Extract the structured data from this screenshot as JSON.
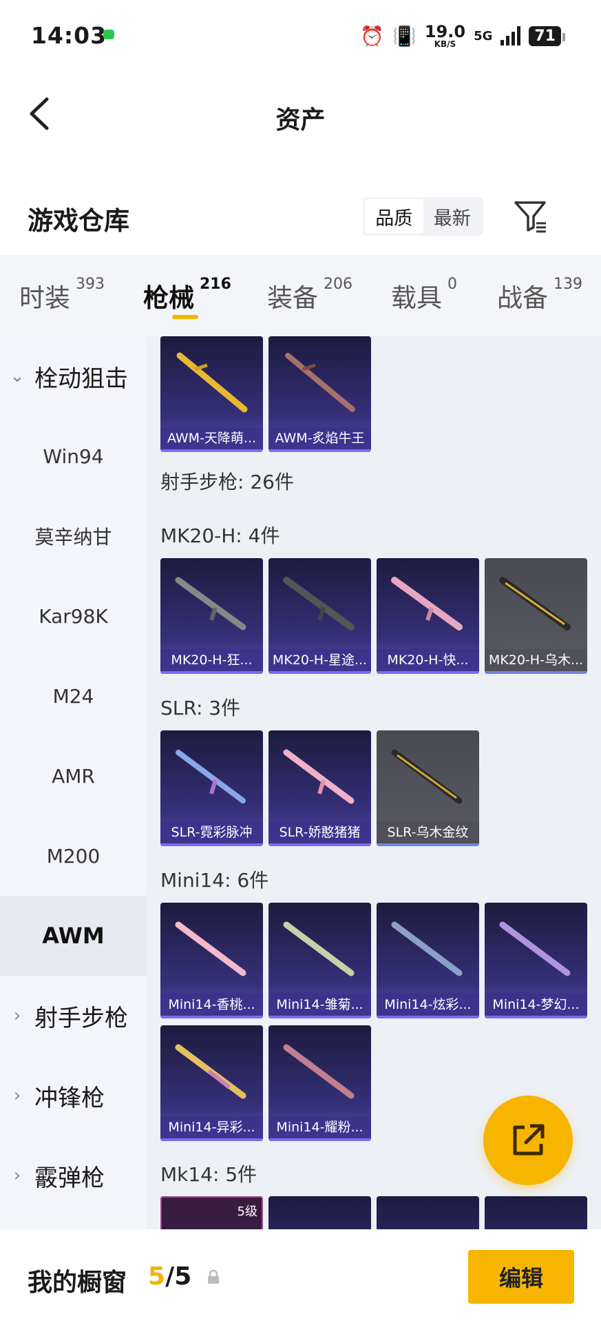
{
  "status": {
    "time": "14:03",
    "speed_value": "19.0",
    "speed_unit": "KB/S",
    "network": "5G",
    "battery": "71"
  },
  "header": {
    "title": "资产"
  },
  "warehouse": {
    "title": "游戏仓库",
    "sort_options": [
      "品质",
      "最新"
    ],
    "selected_sort": "品质"
  },
  "tabs": [
    {
      "label": "时装",
      "count": "393"
    },
    {
      "label": "枪械",
      "count": "216"
    },
    {
      "label": "装备",
      "count": "206"
    },
    {
      "label": "载具",
      "count": "0"
    },
    {
      "label": "战备",
      "count": "139"
    }
  ],
  "active_tab": "枪械",
  "sidebar": {
    "category_open": "栓动狙击",
    "items": [
      "Win94",
      "莫辛纳甘",
      "Kar98K",
      "M24",
      "AMR",
      "M200",
      "AWM"
    ],
    "active_item": "AWM",
    "collapsed_categories": [
      "射手步枪",
      "冲锋枪",
      "霰弹枪"
    ]
  },
  "content": {
    "awm_items": [
      "AWM-天降萌...",
      "AWM-炙焰牛王"
    ],
    "marksman_header": "射手步枪: 26件",
    "mk20_header": "MK20-H: 4件",
    "mk20_items": [
      "MK20-H-狂...",
      "MK20-H-星途...",
      "MK20-H-快...",
      "MK20-H-乌木..."
    ],
    "slr_header": "SLR: 3件",
    "slr_items": [
      "SLR-霓彩脉冲",
      "SLR-娇憨猪猪",
      "SLR-乌木金纹"
    ],
    "mini14_header": "Mini14: 6件",
    "mini14_items": [
      "Mini14-香桃...",
      "Mini14-雏菊...",
      "Mini14-炫彩...",
      "Mini14-梦幻...",
      "Mini14-异彩...",
      "Mini14-耀粉..."
    ],
    "mk14_header": "Mk14: 5件",
    "mk14_level_badge": "5级"
  },
  "bottom": {
    "showcase_label": "我的橱窗",
    "count_current": "5",
    "count_sep": "/",
    "count_total": "5",
    "edit_label": "编辑"
  },
  "colors": {
    "accent": "#f7b500",
    "card_purple": "#36307a",
    "card_gray": "#5a5a63"
  }
}
